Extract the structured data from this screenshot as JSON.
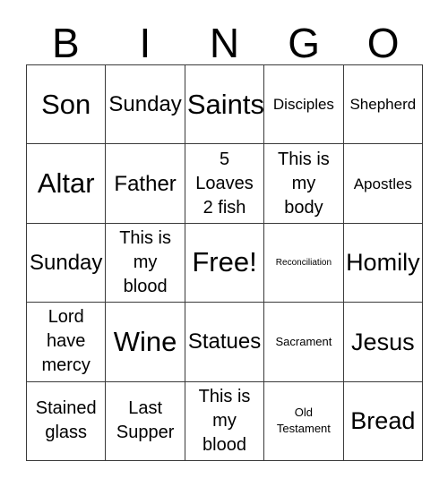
{
  "card": {
    "title_letters": [
      "B",
      "I",
      "N",
      "G",
      "O"
    ],
    "columns": 5,
    "rows": 5,
    "free_space_label": "Free!",
    "colors": {
      "background": "#ffffff",
      "text": "#000000",
      "grid_line": "#3a3a3a"
    },
    "cells": [
      [
        {
          "text": "Son",
          "size": "xxl"
        },
        {
          "text": "Sunday",
          "size": "l"
        },
        {
          "text": "Saints",
          "size": "xxl"
        },
        {
          "text": "Disciples",
          "size": "s"
        },
        {
          "text": "Shepherd",
          "size": "s"
        }
      ],
      [
        {
          "text": "Altar",
          "size": "xxl"
        },
        {
          "text": "Father",
          "size": "l"
        },
        {
          "text": "5\nLoaves\n2 fish",
          "size": "m"
        },
        {
          "text": "This is\nmy\nbody",
          "size": "m"
        },
        {
          "text": "Apostles",
          "size": "s"
        }
      ],
      [
        {
          "text": "Sunday",
          "size": "l"
        },
        {
          "text": "This is\nmy\nblood",
          "size": "m"
        },
        {
          "text": "Free!",
          "size": "xxl"
        },
        {
          "text": "Reconciliation",
          "size": "xxs"
        },
        {
          "text": "Homily",
          "size": "xl"
        }
      ],
      [
        {
          "text": "Lord\nhave\nmercy",
          "size": "m"
        },
        {
          "text": "Wine",
          "size": "xxl"
        },
        {
          "text": "Statues",
          "size": "l"
        },
        {
          "text": "Sacrament",
          "size": "xs"
        },
        {
          "text": "Jesus",
          "size": "xl"
        }
      ],
      [
        {
          "text": "Stained\nglass",
          "size": "m"
        },
        {
          "text": "Last\nSupper",
          "size": "m"
        },
        {
          "text": "This is\nmy\nblood",
          "size": "m"
        },
        {
          "text": "Old\nTestament",
          "size": "xs"
        },
        {
          "text": "Bread",
          "size": "xl"
        }
      ]
    ]
  }
}
